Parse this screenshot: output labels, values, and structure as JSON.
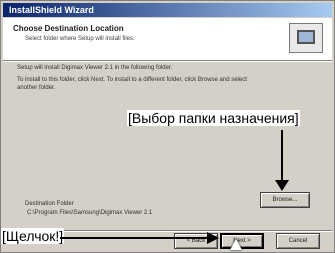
{
  "window": {
    "title": "InstallShield Wizard"
  },
  "header": {
    "title": "Choose Destination Location",
    "subtitle": "Select folder where Setup will install files."
  },
  "body": {
    "line1": "Setup will install Digimax Viewer 2.1 in the following folder.",
    "line2": "To install to this folder, click Next. To install to a different folder, click Browse and select",
    "line3": "another folder."
  },
  "destination": {
    "label": "Destination Folder",
    "path": "C:\\Program Files\\Samsung\\Digimax Viewer 2.1"
  },
  "buttons": {
    "browse": "Browse...",
    "back": "< Back",
    "next": "Next >",
    "cancel": "Cancel"
  },
  "annotations": {
    "folder": "[Выбор папки назначения]",
    "click": "[Щелчок!]"
  },
  "icons": {
    "wizard": "installer-computer-icon",
    "cursor": "mouse-pointer-icon"
  }
}
